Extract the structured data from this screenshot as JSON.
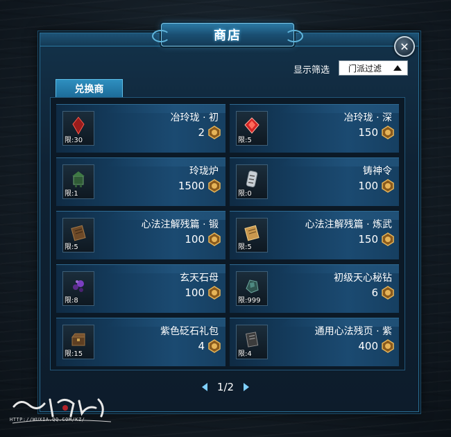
{
  "window": {
    "title": "商店",
    "close_label": "✕"
  },
  "filter": {
    "label": "显示筛选",
    "selected": "门派过滤"
  },
  "tab": {
    "label": "兑换商"
  },
  "items": [
    {
      "name": "冶玲珑 · 初",
      "price": "2",
      "limit": "限:30",
      "icon": "red-crystal-icon",
      "color": "#b02020"
    },
    {
      "name": "冶玲珑 · 深",
      "price": "150",
      "limit": "限:5",
      "icon": "red-gem-icon",
      "color": "#e02828"
    },
    {
      "name": "玲珑炉",
      "price": "1500",
      "limit": "限:1",
      "icon": "furnace-icon",
      "color": "#3f6a3a"
    },
    {
      "name": "铸神令",
      "price": "100",
      "limit": "限:0",
      "icon": "token-icon",
      "color": "#a9b4bd"
    },
    {
      "name": "心法注解残篇 · 锻",
      "price": "100",
      "limit": "限:5",
      "icon": "scroll-icon",
      "color": "#7a5530"
    },
    {
      "name": "心法注解残篇 · 炼武",
      "price": "150",
      "limit": "限:5",
      "icon": "scroll-icon",
      "color": "#c79a52"
    },
    {
      "name": "玄天石母",
      "price": "100",
      "limit": "限:8",
      "icon": "purple-ore-icon",
      "color": "#6b3aa0"
    },
    {
      "name": "初级天心秘钻",
      "price": "6",
      "limit": "限:999",
      "icon": "green-stone-icon",
      "color": "#3c6e6a"
    },
    {
      "name": "紫色砭石礼包",
      "price": "4",
      "limit": "限:15",
      "icon": "chest-icon",
      "color": "#6b4a2a"
    },
    {
      "name": "通用心法残页 · 紫",
      "price": "400",
      "limit": "限:4",
      "icon": "book-icon",
      "color": "#4a4a4a"
    }
  ],
  "pagination": {
    "label": "1/2"
  },
  "watermark": {
    "url": "HTTP://WUXIA.QQ.COM/KZ/"
  },
  "colors": {
    "accent": "#2e8fbf",
    "coin": "#c89a3a"
  }
}
